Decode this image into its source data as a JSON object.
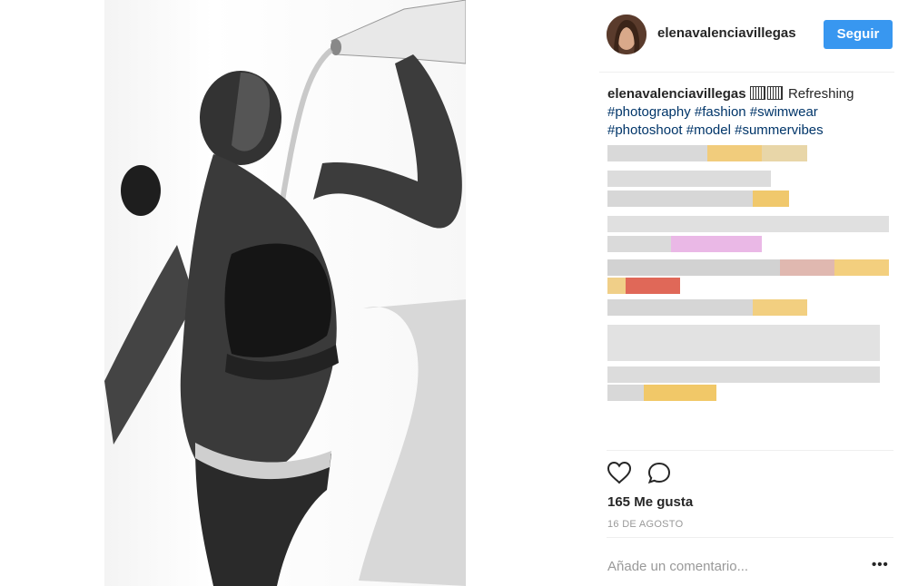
{
  "post": {
    "username": "elenavalenciavillegas",
    "follow_label": "Seguir",
    "caption_text": "Refreshing",
    "hashtags_line1": "#photography #fashion #swimwear",
    "hashtags_line2": "#photoshoot #model #summervibes",
    "likes": "165 Me gusta",
    "date": "16 DE AGOSTO",
    "comment_placeholder": "Añade un comentario...",
    "more_label": "•••"
  },
  "colors": {
    "accent": "#3897f0",
    "hashtag": "#003569",
    "muted": "#999999",
    "divider": "#efefef"
  },
  "icons": [
    "heart-icon",
    "comment-icon",
    "more-options-icon"
  ]
}
